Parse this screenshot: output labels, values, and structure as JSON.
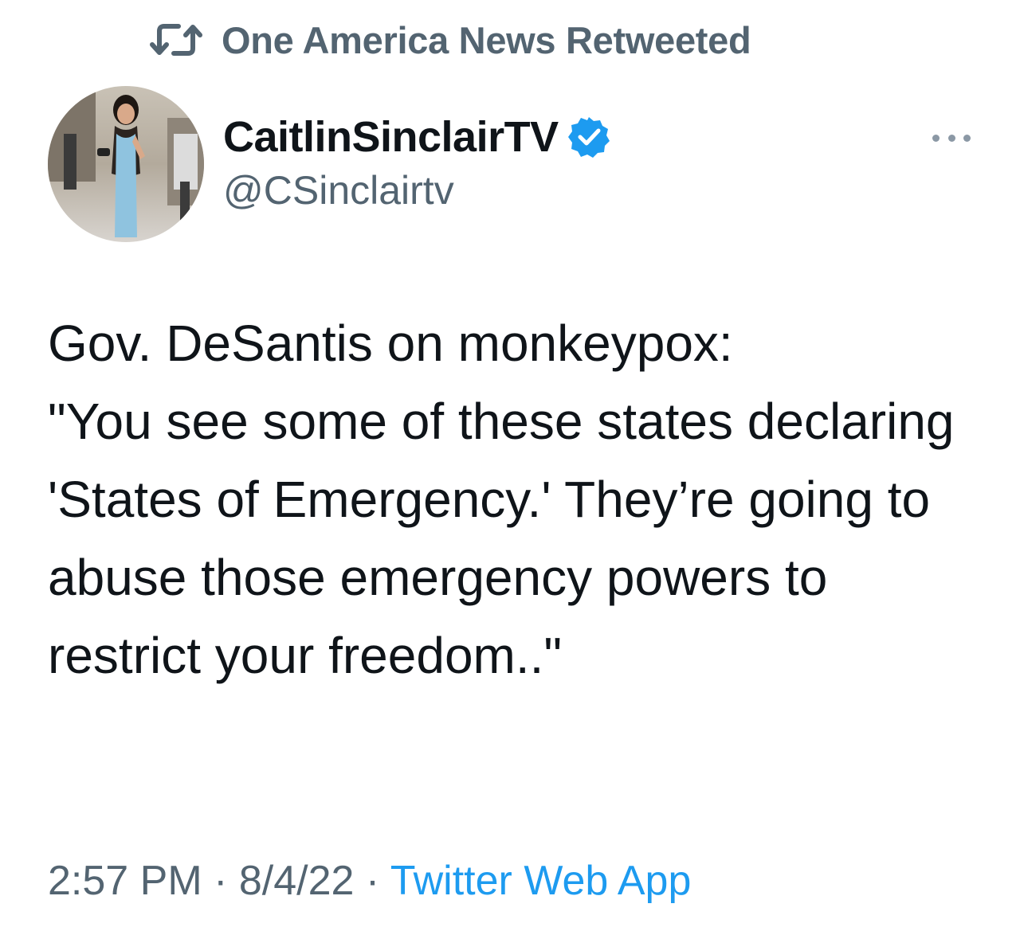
{
  "retweet": {
    "label": "One America News Retweeted",
    "icon": "retweet-icon"
  },
  "author": {
    "display_name": "CaitlinSinclairTV",
    "handle": "@CSinclairtv",
    "verified_icon": "verified-badge-icon",
    "avatar_icon": "avatar-photo"
  },
  "more_icon": "more-options-icon",
  "tweet": {
    "line1": "Gov. DeSantis on monkeypox:",
    "quote": "\"You see some of these states declaring 'States of Emergency.' They’re going to abuse those emergency powers to restrict your freedom..\""
  },
  "meta": {
    "time": "2:57 PM",
    "sep1": " · ",
    "date": "8/4/22",
    "sep2": " · ",
    "source": "Twitter Web App"
  },
  "colors": {
    "text": "#0f1419",
    "secondary": "#536471",
    "link": "#1d9bf0",
    "verified": "#1d9bf0"
  }
}
